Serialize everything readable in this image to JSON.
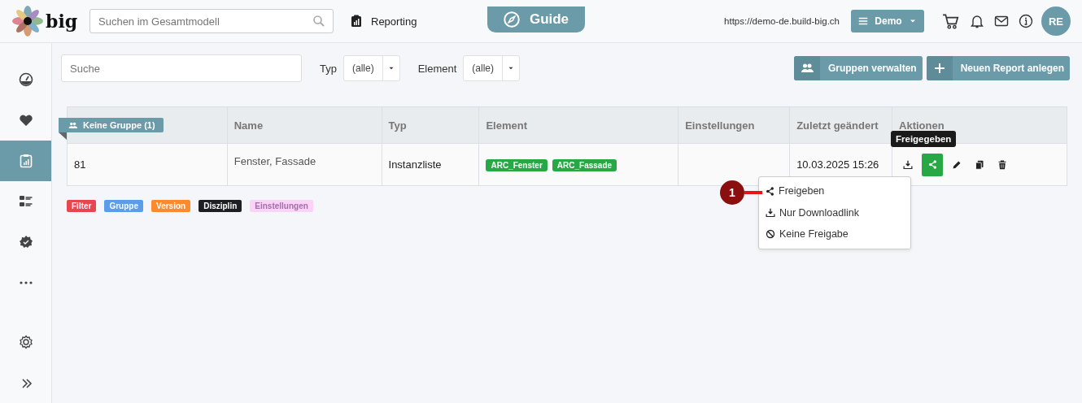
{
  "header": {
    "logo": "big",
    "search": {
      "placeholder": "Suchen im Gesamtmodell"
    },
    "nav_link": "Reporting",
    "guide_tab": "Guide",
    "url": "https://demo-de.build-big.ch",
    "project_button": "Demo",
    "avatar": "RE"
  },
  "sidebar": {
    "items": [
      {
        "kind": "dashboard",
        "selected": false
      },
      {
        "kind": "heart",
        "selected": false
      },
      {
        "kind": "report",
        "selected": true
      },
      {
        "kind": "checklist",
        "selected": false
      },
      {
        "kind": "badge",
        "selected": false
      },
      {
        "kind": "more",
        "selected": false
      }
    ],
    "bottom_items": [
      {
        "kind": "settings"
      },
      {
        "kind": "expand"
      }
    ]
  },
  "filters": {
    "search": {
      "placeholder": "Suche"
    },
    "selects": [
      {
        "label": "Typ",
        "value": "(alle)"
      },
      {
        "label": "Element",
        "value": "(alle)"
      }
    ],
    "buttons": [
      {
        "kind": "group",
        "label": "Gruppen verwalten"
      },
      {
        "kind": "add",
        "label": "Neuen Report anlegen"
      }
    ]
  },
  "table": {
    "group_label": "Keine Gruppe (1)",
    "columns": [
      "",
      "Name",
      "Typ",
      "Element",
      "Einstellungen",
      "Zuletzt geändert",
      "Aktionen"
    ],
    "rows": [
      {
        "id": "81",
        "name": "Fenster, Fassade",
        "type": "Instanzliste",
        "elements": [
          "ARC_Fenster",
          "ARC_Fassade"
        ],
        "settings": "",
        "modified": "10.03.2025 15:26",
        "actions": [
          {
            "kind": "download",
            "active": false
          },
          {
            "kind": "share",
            "active": true
          },
          {
            "kind": "edit",
            "active": false
          },
          {
            "kind": "copy",
            "active": false
          },
          {
            "kind": "delete",
            "active": false
          }
        ]
      }
    ]
  },
  "legend": [
    {
      "label": "Filter",
      "color": "#e8464e"
    },
    {
      "label": "Gruppe",
      "color": "#5c9ce8"
    },
    {
      "label": "Version",
      "color": "#fd8a2c"
    },
    {
      "label": "Disziplin",
      "color": "#1e1f22"
    },
    {
      "label": "Einstellungen",
      "color": "#fbd3f8"
    }
  ],
  "tooltip": "Freigegeben",
  "share_menu": {
    "items": [
      {
        "kind": "share",
        "label": "Freigeben"
      },
      {
        "kind": "download",
        "label": "Nur Downloadlink"
      },
      {
        "kind": "ban",
        "label": "Keine Freigabe"
      }
    ]
  },
  "step_marker": "1"
}
